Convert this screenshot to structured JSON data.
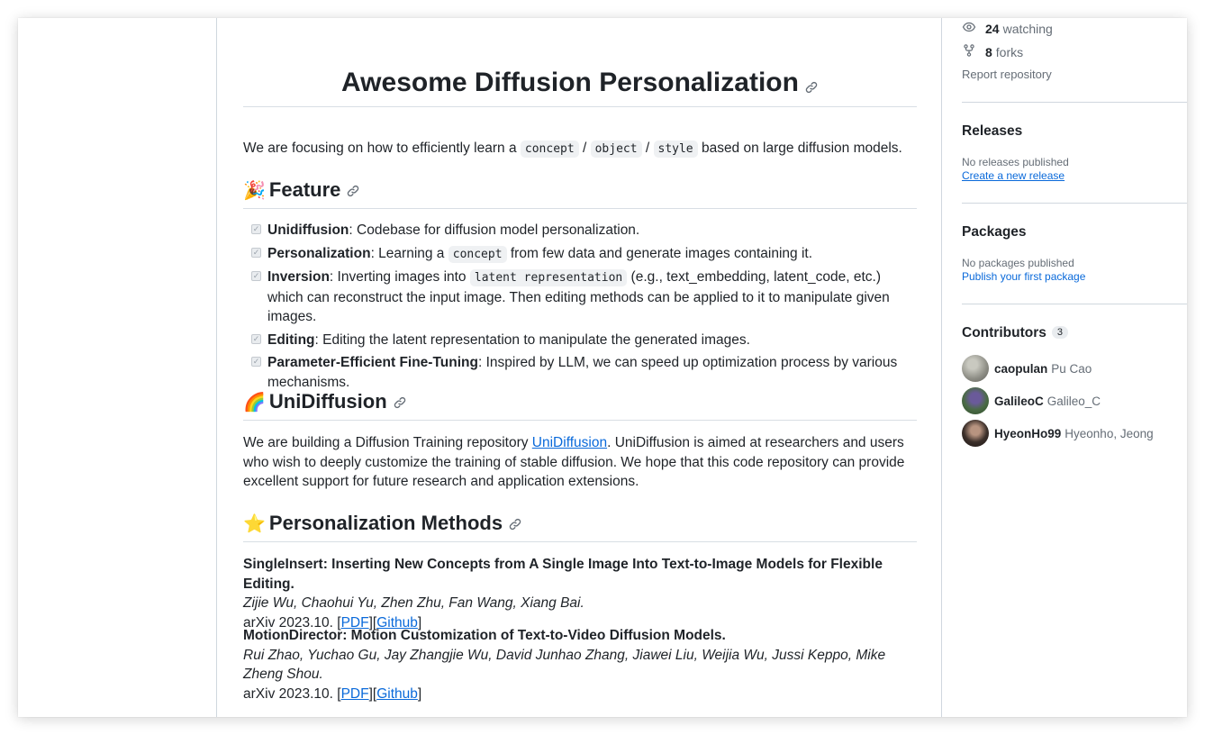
{
  "readme": {
    "title": "Awesome Diffusion Personalization",
    "intro": {
      "text_before": "We are focusing on how to efficiently learn a ",
      "code1": "concept",
      "sep1": " / ",
      "code2": "object",
      "sep2": " / ",
      "code3": "style",
      "text_after": " based on large diffusion models."
    },
    "feature": {
      "emoji": "🎉",
      "heading": "Feature",
      "items": [
        {
          "bold": "Unidiffusion",
          "text": ": Codebase for diffusion model personalization."
        },
        {
          "bold": "Personalization",
          "pre": ": Learning a ",
          "code": "concept",
          "post": " from few data and generate images containing it."
        },
        {
          "bold": "Inversion",
          "pre": ": Inverting images into ",
          "code": "latent representation",
          "post": " (e.g., text_embedding, latent_code, etc.) which can reconstruct the input image. Then editing methods can be applied to it to manipulate given images."
        },
        {
          "bold": "Editing",
          "text": ": Editing the latent representation to manipulate the generated images."
        },
        {
          "bold": "Parameter-Efficient Fine-Tuning",
          "text": ": Inspired by LLM, we can speed up optimization process by various mechanisms."
        }
      ]
    },
    "unidiffusion": {
      "emoji": "🌈",
      "heading": "UniDiffusion",
      "text_before": "We are building a Diffusion Training repository ",
      "link": "UniDiffusion",
      "text_after": ". UniDiffusion is aimed at researchers and users who wish to deeply customize the training of stable diffusion. We hope that this code repository can provide excellent support for future research and application extensions."
    },
    "methods": {
      "emoji": "⭐",
      "heading": "Personalization Methods",
      "papers": [
        {
          "title": "SingleInsert: Inserting New Concepts from A Single Image Into Text-to-Image Models for Flexible Editing.",
          "authors": "Zijie Wu, Chaohui Yu, Zhen Zhu, Fan Wang, Xiang Bai.",
          "venue": "arXiv 2023.10. ",
          "pdf": "PDF",
          "github": "Github"
        },
        {
          "title": "MotionDirector: Motion Customization of Text-to-Video Diffusion Models.",
          "authors": "Rui Zhao, Yuchao Gu, Jay Zhangjie Wu, David Junhao Zhang, Jiawei Liu, Weijia Wu, Jussi Keppo, Mike Zheng Shou.",
          "venue": "arXiv 2023.10. ",
          "pdf": "PDF",
          "github": "Github"
        }
      ]
    }
  },
  "sidebar": {
    "watching_count": "24",
    "watching_label": "watching",
    "forks_count": "8",
    "forks_label": "forks",
    "report": "Report repository",
    "releases": {
      "title": "Releases",
      "status": "No releases published",
      "link": "Create a new release"
    },
    "packages": {
      "title": "Packages",
      "status": "No packages published",
      "link": "Publish your first package"
    },
    "contributors": {
      "title": "Contributors",
      "count": "3",
      "list": [
        {
          "login": "caopulan",
          "name": "Pu Cao",
          "avatar_color": "#8d8d85"
        },
        {
          "login": "GalileoC",
          "name": "Galileo_C",
          "avatar_color": "#4a6b45"
        },
        {
          "login": "HyeonHo99",
          "name": "Hyeonho, Jeong",
          "avatar_color": "#3b2f2a"
        }
      ]
    }
  },
  "colors": {
    "link": "#0969da",
    "text": "#1f2328",
    "muted": "#656d76",
    "border": "#d0d7de"
  }
}
